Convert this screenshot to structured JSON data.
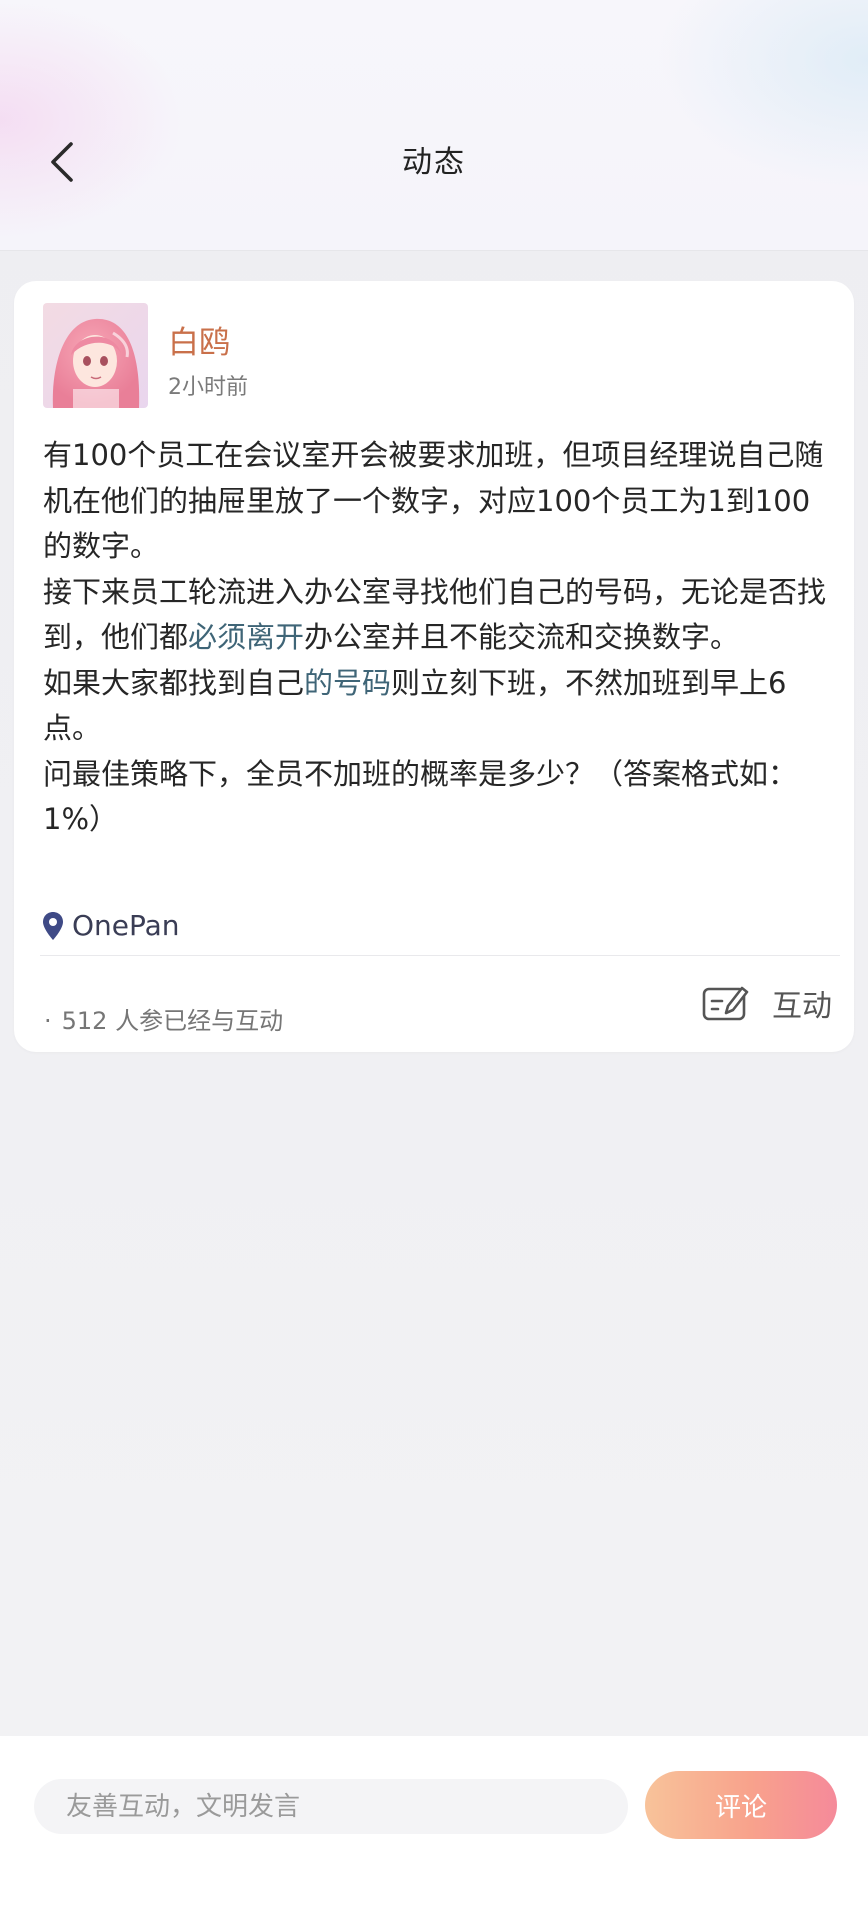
{
  "header": {
    "title": "动态",
    "back_icon": "chevron-left-icon"
  },
  "post": {
    "author": "白鸥",
    "time": "2小时前",
    "avatar_icon": "pink-hair-anime-avatar",
    "body": {
      "p1": "有100个员工在会议室开会被要求加班，但项目经理说自己随机在他们的抽屉里放了一个数字，对应100个员工为1到100的数字。",
      "p2_a": "接下来员工轮流进入办公室寻找他们自己的号码，无论是否找到，他们都",
      "p2_hl": "必须离开",
      "p2_b": "办公室并且不能交流和交换数字。",
      "p3_a": "如果大家都找到自己",
      "p3_hl": "的号码",
      "p3_b": "则立刻下班，不然加班到早上6点。",
      "p4": "问最佳策略下，全员不加班的概率是多少？（答案格式如：1%）"
    },
    "highlight_color": "#3f6577",
    "location": "OnePan",
    "location_icon": "map-pin-icon",
    "participants_dot": "·",
    "participants_text": "512 人参已经与互动",
    "interact_label": "互动",
    "interact_icon": "edit-note-icon"
  },
  "comment_bar": {
    "placeholder": "友善互动，文明发言",
    "submit_label": "评论",
    "accent_gradient": [
      "#f8c39a",
      "#f58a9a"
    ]
  },
  "colors": {
    "author_name": "#c9704a",
    "background": "#f0f0f3"
  }
}
